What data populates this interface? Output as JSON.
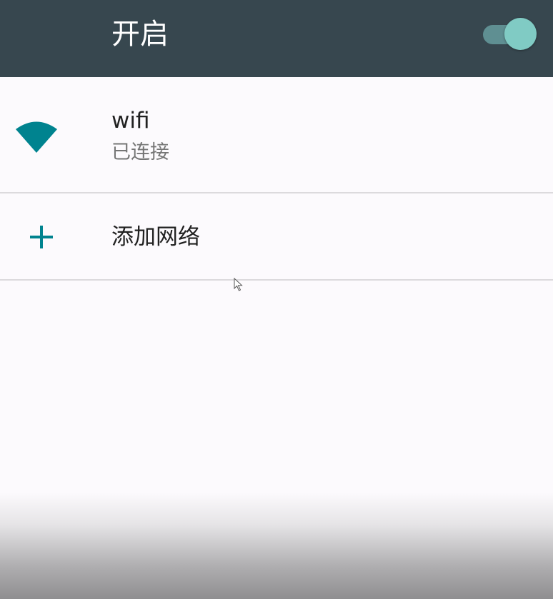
{
  "master_switch": {
    "label": "开启",
    "state": "on",
    "track_color": "#5f8f92",
    "thumb_color": "#80cbc4"
  },
  "networks": [
    {
      "name": "wifi",
      "status": "已连接",
      "icon": "wifi-signal-icon",
      "icon_color": "#00838f"
    }
  ],
  "add_network": {
    "label": "添加网络",
    "icon": "plus-icon",
    "icon_color": "#00838f"
  },
  "colors": {
    "header_bg": "#37474f",
    "page_bg": "#fcfafd",
    "accent": "#00838f"
  }
}
